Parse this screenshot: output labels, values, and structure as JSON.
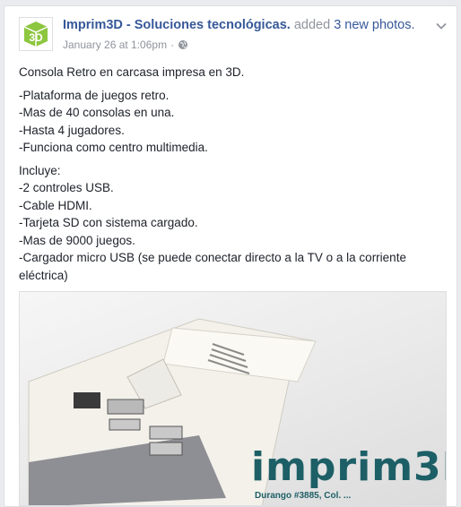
{
  "post": {
    "page_name": "Imprim3D - Soluciones tecnológicas.",
    "action_text": "added",
    "photos_text": "3 new photos.",
    "timestamp": "January 26 at 1:06pm",
    "separator": "·",
    "privacy_icon": "globe-icon",
    "options_icon": "chevron-down-icon",
    "avatar_logo_text": "3D",
    "intro": "Consola Retro en carcasa impresa en 3D.",
    "features": [
      "-Plataforma de juegos retro.",
      "-Mas de 40 consolas en una.",
      "-Hasta 4 jugadores.",
      "-Funciona como centro multimedia."
    ],
    "includes_heading": "Incluye:",
    "includes": [
      "-2 controles USB.",
      "-Cable HDMI.",
      "-Tarjeta SD con sistema cargado.",
      "-Mas de 9000 juegos.",
      "-Cargador micro USB (se puede conectar directo a la TV o a la corriente eléctrica)"
    ],
    "photo": {
      "watermark": "imprim3D",
      "watermark_sub": "Durango #3885, Col. ..."
    }
  },
  "colors": {
    "link": "#365899",
    "meta": "#90949c",
    "text": "#1d2129",
    "logo_green": "#8dc63f"
  }
}
